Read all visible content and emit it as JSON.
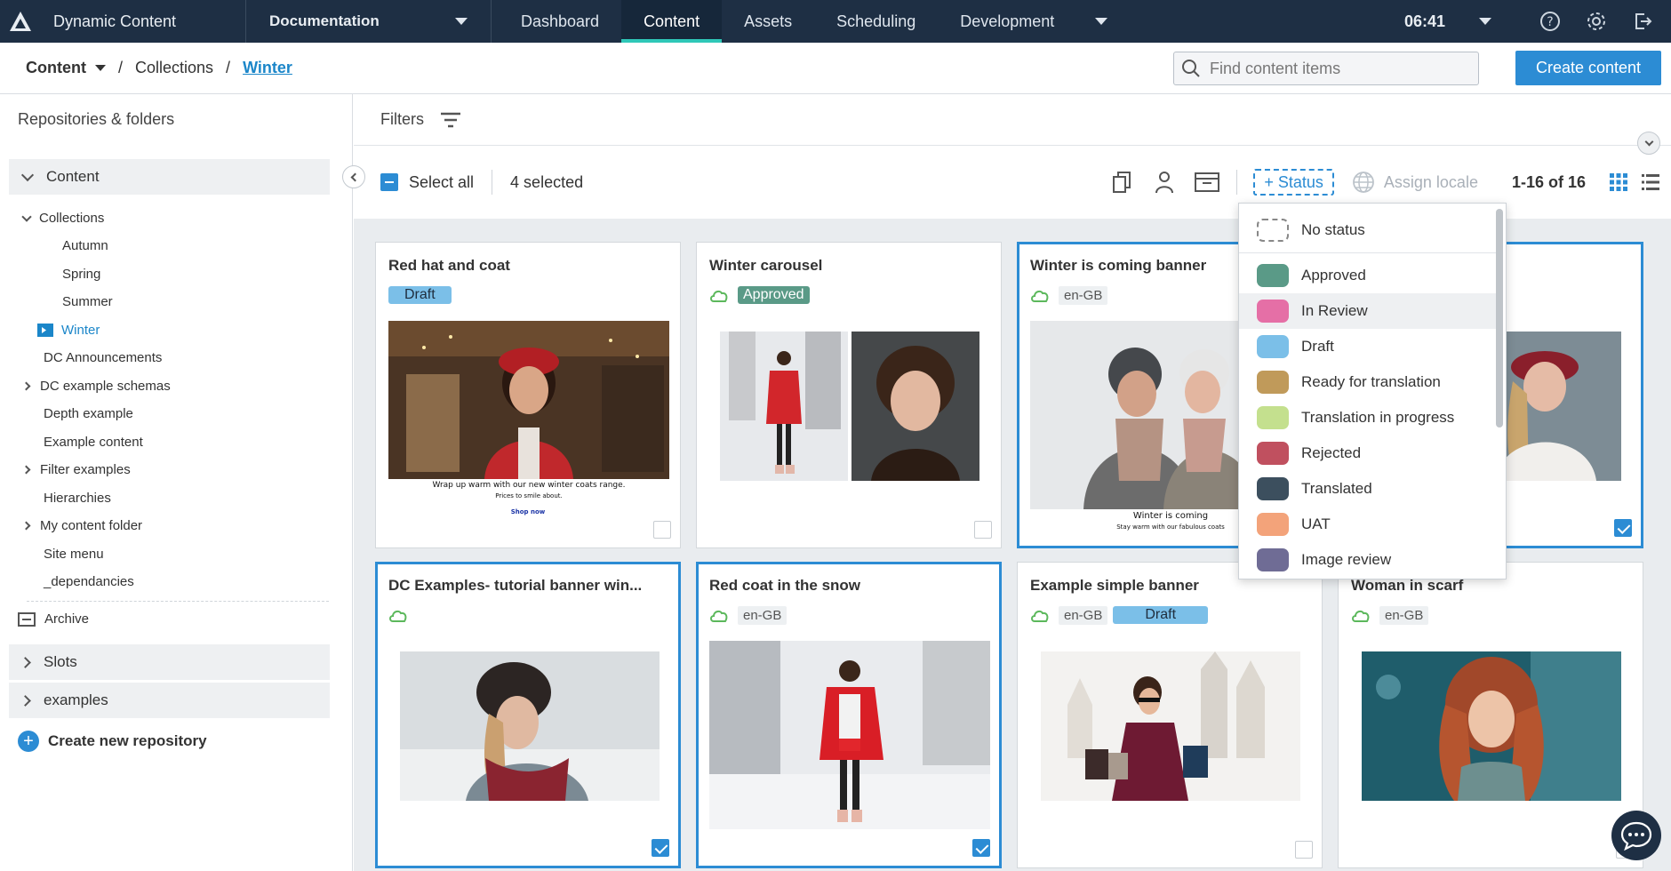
{
  "topbar": {
    "app_name": "Dynamic Content",
    "hub": "Documentation",
    "tabs": [
      {
        "label": "Dashboard"
      },
      {
        "label": "Content",
        "active": true
      },
      {
        "label": "Assets"
      },
      {
        "label": "Scheduling"
      },
      {
        "label": "Development",
        "has_menu": true
      }
    ],
    "clock": "06:41",
    "icons": [
      "help-icon",
      "settings-icon",
      "logout-icon"
    ]
  },
  "breadcrumb": {
    "root": "Content",
    "middle": "Collections",
    "current": "Winter"
  },
  "search": {
    "placeholder": "Find content items"
  },
  "create_button": "Create content",
  "sidebar": {
    "title": "Repositories & folders",
    "repo_content": "Content",
    "tree": [
      {
        "label": "Collections",
        "expanded": true
      },
      {
        "label": "Autumn"
      },
      {
        "label": "Spring"
      },
      {
        "label": "Summer"
      },
      {
        "label": "Winter",
        "selected": true
      },
      {
        "label": "DC Announcements"
      },
      {
        "label": "DC example schemas",
        "collapsed": true
      },
      {
        "label": "Depth example"
      },
      {
        "label": "Example content"
      },
      {
        "label": "Filter examples",
        "collapsed": true
      },
      {
        "label": "Hierarchies"
      },
      {
        "label": "My content folder",
        "collapsed": true
      },
      {
        "label": "Site menu"
      },
      {
        "label": "_dependancies"
      }
    ],
    "archive": "Archive",
    "repos": [
      "Slots",
      "examples"
    ],
    "create_repo": "Create new repository"
  },
  "filters": {
    "label": "Filters"
  },
  "toolbar": {
    "select_all": "Select all",
    "selected": "4 selected",
    "status_button": "+ Status",
    "assign_locale": "Assign locale",
    "pager": "1-16 of 16"
  },
  "status_menu": {
    "items": [
      {
        "label": "No status",
        "color": "none"
      },
      {
        "label": "Approved",
        "color": "#5a9a87"
      },
      {
        "label": "In Review",
        "color": "#e56fa6"
      },
      {
        "label": "Draft",
        "color": "#7bbfe8"
      },
      {
        "label": "Ready for translation",
        "color": "#c09a5a"
      },
      {
        "label": "Translation in progress",
        "color": "#c4e08e"
      },
      {
        "label": "Rejected",
        "color": "#c0505f"
      },
      {
        "label": "Translated",
        "color": "#3c4f5e"
      },
      {
        "label": "UAT",
        "color": "#f3a37a"
      },
      {
        "label": "Image review",
        "color": "#6f6c95"
      }
    ],
    "hovered": "In Review"
  },
  "cards": [
    {
      "title": "Red hat and coat",
      "status": "Draft",
      "checked": false,
      "banner_line1": "Wrap up warm with our new winter coats range.",
      "banner_line2": "Prices to smile about.",
      "banner_link": "Shop now"
    },
    {
      "title": "Winter carousel",
      "status": "Approved",
      "checked": false
    },
    {
      "title": "Winter is coming banner",
      "locale": "en-GB",
      "checked": true,
      "banner_line1": "Winter is coming",
      "banner_line2": "Stay warm with our fabulous coats"
    },
    {
      "title": "",
      "checked": true
    },
    {
      "title": "DC Examples- tutorial banner win...",
      "checked": true
    },
    {
      "title": "Red coat in the snow",
      "locale": "en-GB",
      "checked": true
    },
    {
      "title": "Example simple banner",
      "locale": "en-GB",
      "status": "Draft",
      "checked": false
    },
    {
      "title": "Woman in scarf",
      "locale": "en-GB",
      "checked": false
    }
  ],
  "colors": {
    "topbar": "#1e2f44",
    "accent": "#2c8cd4",
    "active_tab_underline": "#2fc7b8",
    "cloud": "#5cb85c"
  }
}
